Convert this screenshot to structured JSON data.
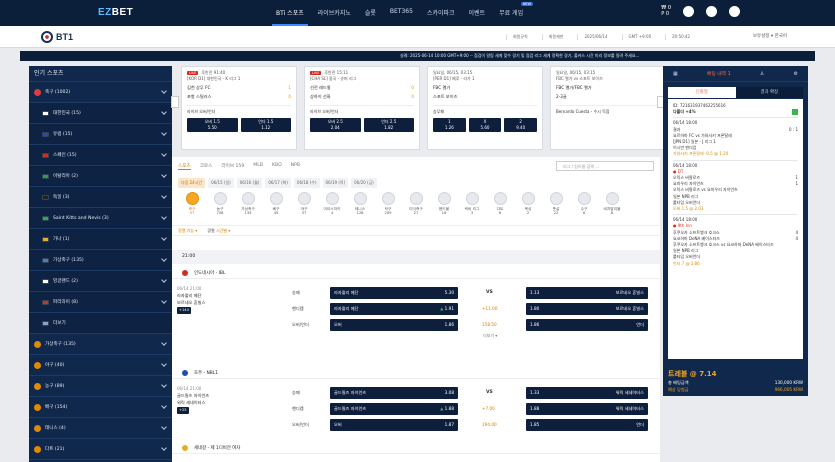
{
  "topnav": {
    "logo_prefix": "EZ",
    "logo_suffix": "BET",
    "items": [
      {
        "label": "BTi 스포츠",
        "active": true
      },
      {
        "label": "라이브카지노"
      },
      {
        "label": "슬롯"
      },
      {
        "label": "BET365"
      },
      {
        "label": "스카이파크"
      },
      {
        "label": "이벤트"
      },
      {
        "label": "무료 게임",
        "badge": "NEW"
      }
    ],
    "balance_1": "0",
    "balance_2": "0"
  },
  "subbar": {
    "brand": "BT1",
    "info": [
      "회원규칙",
      "회원제한",
      "2025/06/14",
      "GMT +9:00",
      "20:50:42"
    ],
    "settings": "보유설정 ▾  한국어"
  },
  "ticker": "실례: 2025-06-14 10:00 GMT+9:00 -- 점검이 알림 세계 맞수 경기 및 점검 리그 세계 정확한 경기, 풀커스 시간 미리 정보를 알려 주세요...",
  "sidebar": {
    "title": "인기 스포츠",
    "items": [
      {
        "label": "축구 (1002)",
        "color": "#e33b3b",
        "type": "sport"
      },
      {
        "label": "대한민국 (15)",
        "flag": "kr",
        "type": "country"
      },
      {
        "label": "유럽 (15)",
        "flag": "eu",
        "type": "country"
      },
      {
        "label": "스페인 (15)",
        "flag": "es",
        "type": "country"
      },
      {
        "label": "이탈리아 (2)",
        "flag": "it",
        "type": "country"
      },
      {
        "label": "독일 (3)",
        "flag": "de",
        "type": "country"
      },
      {
        "label": "Saint Kitts and Nevis (3)",
        "flag": "kn",
        "type": "country"
      },
      {
        "label": "가나 (1)",
        "flag": "gh",
        "type": "country"
      },
      {
        "label": "가상축구 (135)",
        "flag": "vs",
        "type": "country"
      },
      {
        "label": "잉글랜드 (2)",
        "flag": "en",
        "type": "country"
      },
      {
        "label": "파라과이 (8)",
        "flag": "py",
        "type": "country"
      },
      {
        "label": "더보기",
        "flag": "more",
        "type": "country"
      },
      {
        "label": "가상축구 (135)",
        "color": "#e08a00",
        "type": "sport"
      },
      {
        "label": "야구 (40)",
        "color": "#e08a00",
        "type": "sport"
      },
      {
        "label": "농구 (89)",
        "color": "#e08a00",
        "type": "sport"
      },
      {
        "label": "배구 (154)",
        "color": "#e08a00",
        "type": "sport"
      },
      {
        "label": "테니스 (4)",
        "color": "#e08a00",
        "type": "sport"
      },
      {
        "label": "다트 (21)",
        "color": "#e08a00",
        "type": "sport"
      }
    ]
  },
  "cards": [
    {
      "live": "LIVE",
      "time": "후반전 91:40",
      "league": "[KOR D1] 대한민국 - K 리그 1",
      "team1": "김천 상무 FC",
      "score1": "1",
      "team2": "포항 스틸러스",
      "score2": "0",
      "market": "라이브 오버/언더",
      "odds": [
        [
          "오버 1.5",
          "5.50"
        ],
        [
          "언더 1.5",
          "1.12"
        ]
      ]
    },
    {
      "live": "LIVE",
      "time": "후반전 15:11",
      "league": "[CHA SL] 중국 - 슈퍼 리그",
      "team1": "선전 레드윙",
      "score1": "0",
      "team2": "상하이 선화",
      "score2": "0",
      "market": "라이브 오버/언더",
      "odds": [
        [
          "오버 2.5",
          "2.04"
        ],
        [
          "언더 2.5",
          "1.82"
        ]
      ]
    },
    {
      "live": "",
      "time": "일요일, 06/15, 03:15",
      "league": "[PER D1] 페루 - 리가 1",
      "team1": "FBC 멜가",
      "score1": "",
      "team2": "스포트 보이즈",
      "score2": "",
      "market": "승무패",
      "odds": [
        [
          "1",
          "1.26"
        ],
        [
          "X",
          "5.60"
        ],
        [
          "2",
          "9.40"
        ]
      ]
    },
    {
      "live": "",
      "time": "일요일, 06/15, 03:15",
      "league": "FBC 멜가 vs 스포트 보이즈",
      "team1": "FBC 멜가/FBC 멜가",
      "score1": "",
      "team2": "2-3골",
      "score2": "",
      "market": "Bernardo Cuesta - 수시 득점",
      "odds": []
    }
  ],
  "panel": {
    "tabs": [
      "스포츠",
      "크로스",
      "라이브 159",
      "MLB",
      "KBO",
      "NPB"
    ],
    "search_placeholder": "리그 / 팀이름 검색 ...",
    "days": [
      "다음 24시간",
      "06/15 (일)",
      "06/16 (월)",
      "06/17 (화)",
      "06/18 (수)",
      "06/19 (목)",
      "06/20 (금)"
    ],
    "categories": [
      {
        "name": "축구",
        "count": "57"
      },
      {
        "name": "농구",
        "count": "708"
      },
      {
        "name": "가상축구",
        "count": "135"
      },
      {
        "name": "배구",
        "count": "45"
      },
      {
        "name": "야구",
        "count": "37"
      },
      {
        "name": "아이스하키",
        "count": "4"
      },
      {
        "name": "테니스",
        "count": "128"
      },
      {
        "name": "탁구",
        "count": "209"
      },
      {
        "name": "미식축구",
        "count": "27"
      },
      {
        "name": "핸드볼",
        "count": "16"
      },
      {
        "name": "럭비 리그",
        "count": "3"
      },
      {
        "name": "다트",
        "count": "6"
      },
      {
        "name": "복싱",
        "count": "2"
      },
      {
        "name": "풋살",
        "count": "22"
      },
      {
        "name": "수구",
        "count": "6"
      },
      {
        "name": "비치발리볼",
        "count": "8"
      }
    ],
    "filter_left": "정렬 기능 ▾",
    "filter_mid": "경렬",
    "filter_right": "시간별 ▾",
    "time_header": "21:00",
    "matches": [
      {
        "league": "인도네시아 - IBL",
        "date": "06/14 21:00",
        "home": "라자왈리 메단",
        "away": "보르네오 혼빌스",
        "plus": "+144",
        "more": "더보기 ▾",
        "rows": [
          {
            "label": "승패",
            "left": "라자왈리 메단",
            "lo": "5.30",
            "mid": "VS",
            "right": "1.13",
            "rname": "보르네오 혼빌스"
          },
          {
            "label": "핸디캡",
            "left": "라자왈리 메단",
            "lo": "1.91",
            "mid": "+11.00",
            "right": "1.80",
            "rname": "보르네오 혼빌스"
          },
          {
            "label": "오버/언더",
            "left": "오버",
            "lo": "1.86",
            "mid": "158.50",
            "right": "1.86",
            "rname": "언더"
          }
        ]
      },
      {
        "league": "호주 - NBL1",
        "date": "06/14 21:00",
        "home": "골드필즈 자이언츠",
        "away": "워릭 세네이터스",
        "plus": "+25",
        "more": "",
        "rows": [
          {
            "label": "승패",
            "left": "골드필즈 자이언츠",
            "lo": "3.08",
            "mid": "VS",
            "right": "1.33",
            "rname": "워릭 세네이터스"
          },
          {
            "label": "핸디캡",
            "left": "골드필즈 자이언츠",
            "lo": "1.88",
            "mid": "+7.00",
            "right": "1.88",
            "rname": "워릭 세네이터스"
          },
          {
            "label": "오버/언더",
            "left": "오버",
            "lo": "1.87",
            "mid": "194.00",
            "right": "1.85",
            "rname": "언더"
          }
        ]
      }
    ],
    "next_league": "세네갈 - 제 1디비전 여자"
  },
  "slip": {
    "title": "배팅 내역 1",
    "tab_single": "단폴형",
    "tab_result": "결과 확정",
    "id": "ID: 721631937462255616",
    "bet_type": "다폴더 +4%",
    "lines": [
      "06/14 18:00",
      "결과",
      "요르하마 FC vs 가와사키 프론탈레",
      "[JPN D1] 일본 - J 리그 1",
      "이시만 맨더업",
      "가와사키 프론탈레 -0.5 @ 1.20",
      "06/14 18:00",
      "DT",
      "오릭스 버팔로즈",
      "요미우리 자이언츠",
      "오릭스 버팔로즈 vs 요미우리 자이언츠",
      "일본 NPB 리그",
      "롤타임 오버언더",
      "오버 1.5 @ 2.03",
      "06/14 18:00",
      "9th Inn",
      "후쿠오카 소프트뱅크 호크스",
      "요코하마 DeNA 베이스타즈",
      "후쿠오카 소프트뱅크 호크스 vs 요코하마 DeNA 베이스타즈",
      "일본 NPB 리그",
      "롤타임 오버언더",
      "언더 7 @ 1.86"
    ],
    "score_top": "0 : 1",
    "score_mid_1": "1",
    "score_mid_2": "1",
    "score_low_1": "4",
    "score_low_2": "4",
    "total_label": "트레블 @ 7.14",
    "stake_label": "총 배팅금액",
    "stake_value": "130,000 KRW",
    "win_label": "예상 당첨금",
    "win_value": "966,005 KRW"
  }
}
